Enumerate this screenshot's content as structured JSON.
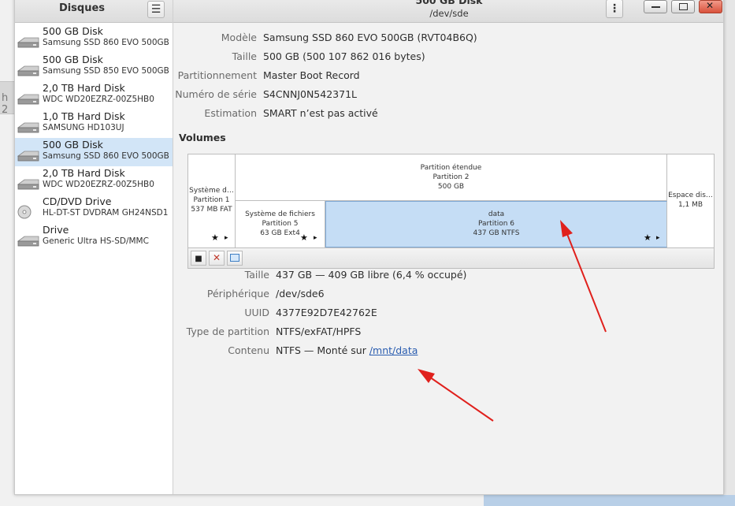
{
  "background": {
    "left_tab_text": "h 2"
  },
  "sidebar": {
    "title": "Disques",
    "menu_icon": "hamburger-icon",
    "items": [
      {
        "name": "500 GB Disk",
        "model": "Samsung SSD 860 EVO 500GB",
        "icon": "hard-disk-icon",
        "selected": false
      },
      {
        "name": "500 GB Disk",
        "model": "Samsung SSD 850 EVO 500GB",
        "icon": "hard-disk-icon",
        "selected": false
      },
      {
        "name": "2,0 TB Hard Disk",
        "model": "WDC WD20EZRZ-00Z5HB0",
        "icon": "hard-disk-icon",
        "selected": false
      },
      {
        "name": "1,0 TB Hard Disk",
        "model": "SAMSUNG HD103UJ",
        "icon": "hard-disk-icon",
        "selected": false
      },
      {
        "name": "500 GB Disk",
        "model": "Samsung SSD 860 EVO 500GB",
        "icon": "hard-disk-icon",
        "selected": true
      },
      {
        "name": "2,0 TB Hard Disk",
        "model": "WDC WD20EZRZ-00Z5HB0",
        "icon": "hard-disk-icon",
        "selected": false
      },
      {
        "name": "CD/DVD Drive",
        "model": "HL-DT-ST DVDRAM GH24NSD1",
        "icon": "optical-disc-icon",
        "selected": false
      },
      {
        "name": "Drive",
        "model": "Generic Ultra HS-SD/MMC",
        "icon": "hard-disk-icon",
        "selected": false
      }
    ]
  },
  "header": {
    "title": "500 GB Disk",
    "subtitle": "/dev/sde"
  },
  "disk_info": {
    "model_label": "Modèle",
    "model_value": "Samsung SSD 860 EVO 500GB (RVT04B6Q)",
    "size_label": "Taille",
    "size_value": "500 GB (500 107 862 016 bytes)",
    "partitioning_label": "Partitionnement",
    "partitioning_value": "Master Boot Record",
    "serial_label": "Numéro de série",
    "serial_value": "S4CNNJ0N542371L",
    "assessment_label": "Estimation",
    "assessment_value": "SMART n’est pas activé"
  },
  "volumes": {
    "title": "Volumes",
    "partition1": {
      "line1": "Système d…",
      "line2": "Partition 1",
      "line3": "537 MB FAT"
    },
    "extended": {
      "line1": "Partition étendue",
      "line2": "Partition 2",
      "line3": "500 GB"
    },
    "partition5": {
      "line1": "Système de fichiers",
      "line2": "Partition 5",
      "line3": "63 GB Ext4"
    },
    "partition6": {
      "line1": "data",
      "line2": "Partition 6",
      "line3": "437 GB NTFS"
    },
    "free_space": {
      "line1": "Espace dis…",
      "line2": "1,1 MB"
    },
    "star": "★",
    "play": "▸",
    "toolbar": {
      "stop_glyph": "■",
      "delete_glyph": "✕"
    }
  },
  "volume_info": {
    "size_label": "Taille",
    "size_value": "437 GB — 409 GB libre (6,4 % occupé)",
    "device_label": "Périphérique",
    "device_value": "/dev/sde6",
    "uuid_label": "UUID",
    "uuid_value": "4377E92D7E42762E",
    "ptype_label": "Type de partition",
    "ptype_value": "NTFS/exFAT/HPFS",
    "contents_label": "Contenu",
    "contents_prefix": "NTFS — Monté sur ",
    "contents_link": "/mnt/data"
  },
  "colors": {
    "selection": "#d2e5f7",
    "selected_partition": "#c5ddf5",
    "link": "#2a5db0",
    "annotation_arrow": "#e0201c"
  }
}
